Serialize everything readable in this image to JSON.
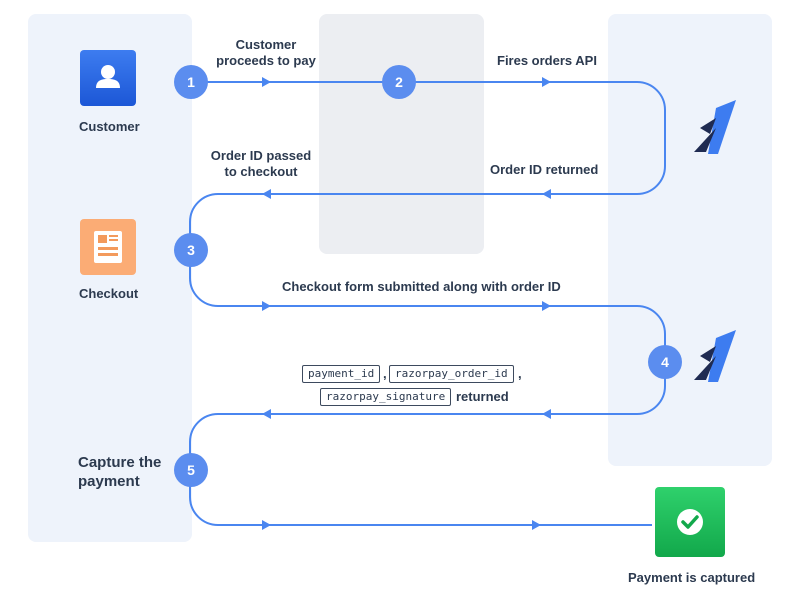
{
  "steps": [
    "1",
    "2",
    "3",
    "4",
    "5"
  ],
  "actors": {
    "customer": "Customer",
    "checkout": "Checkout",
    "capture": "Capture the payment",
    "captured": "Payment is captured"
  },
  "flow": {
    "customer_proceeds": "Customer proceeds to pay",
    "fires_orders_api": "Fires orders API",
    "order_id_passed": "Order ID passed to checkout",
    "order_id_returned": "Order ID returned",
    "checkout_submitted": "Checkout form submitted along with order ID",
    "returned_word": "returned"
  },
  "params": {
    "payment_id": "payment_id",
    "order_id": "razorpay_order_id",
    "signature": "razorpay_signature"
  },
  "icons": {
    "customer": "user-icon",
    "checkout": "document-icon",
    "razorpay": "razorpay-logo-icon",
    "captured": "checkmark-icon"
  },
  "colors": {
    "flow_line": "#4a86f0",
    "step_circle": "#5b8def",
    "panel_bg": "#eef3fb",
    "customer_icon": "#2563e0",
    "checkout_icon": "#fbac75",
    "captured_icon": "#1fbf5d",
    "razorpay_dark": "#1f2b52",
    "razorpay_blue": "#3d7cf0"
  }
}
